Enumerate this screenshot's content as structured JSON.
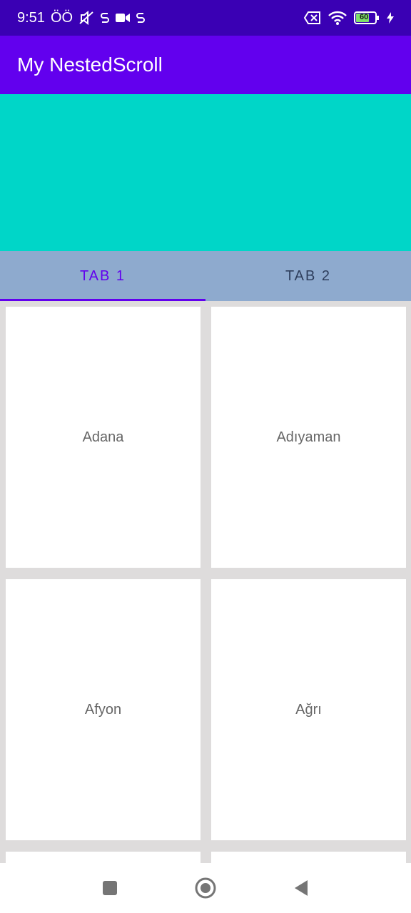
{
  "status_bar": {
    "time": "9:51",
    "carrier": "ÖÖ",
    "icons_left": [
      "muted-icon",
      "stop-sync-icon",
      "video-icon",
      "sync-icon"
    ],
    "icons_right": [
      "sim-off-icon",
      "wifi-icon",
      "battery-icon",
      "charging-icon"
    ],
    "battery": "60"
  },
  "app_bar": {
    "title": "My NestedScroll"
  },
  "colors": {
    "status_bar": "#3a00b4",
    "app_bar": "#6200ee",
    "banner": "#00d6c8",
    "tab_bar": "#8eaace",
    "accent": "#6200ee"
  },
  "tabs": [
    {
      "label": "TAB 1",
      "selected": true
    },
    {
      "label": "TAB 2",
      "selected": false
    }
  ],
  "cities": [
    "Adana",
    "Adıyaman",
    "Afyon",
    "Ağrı"
  ],
  "nav_bar": {
    "buttons": [
      "recents-icon",
      "home-icon",
      "back-icon"
    ]
  }
}
